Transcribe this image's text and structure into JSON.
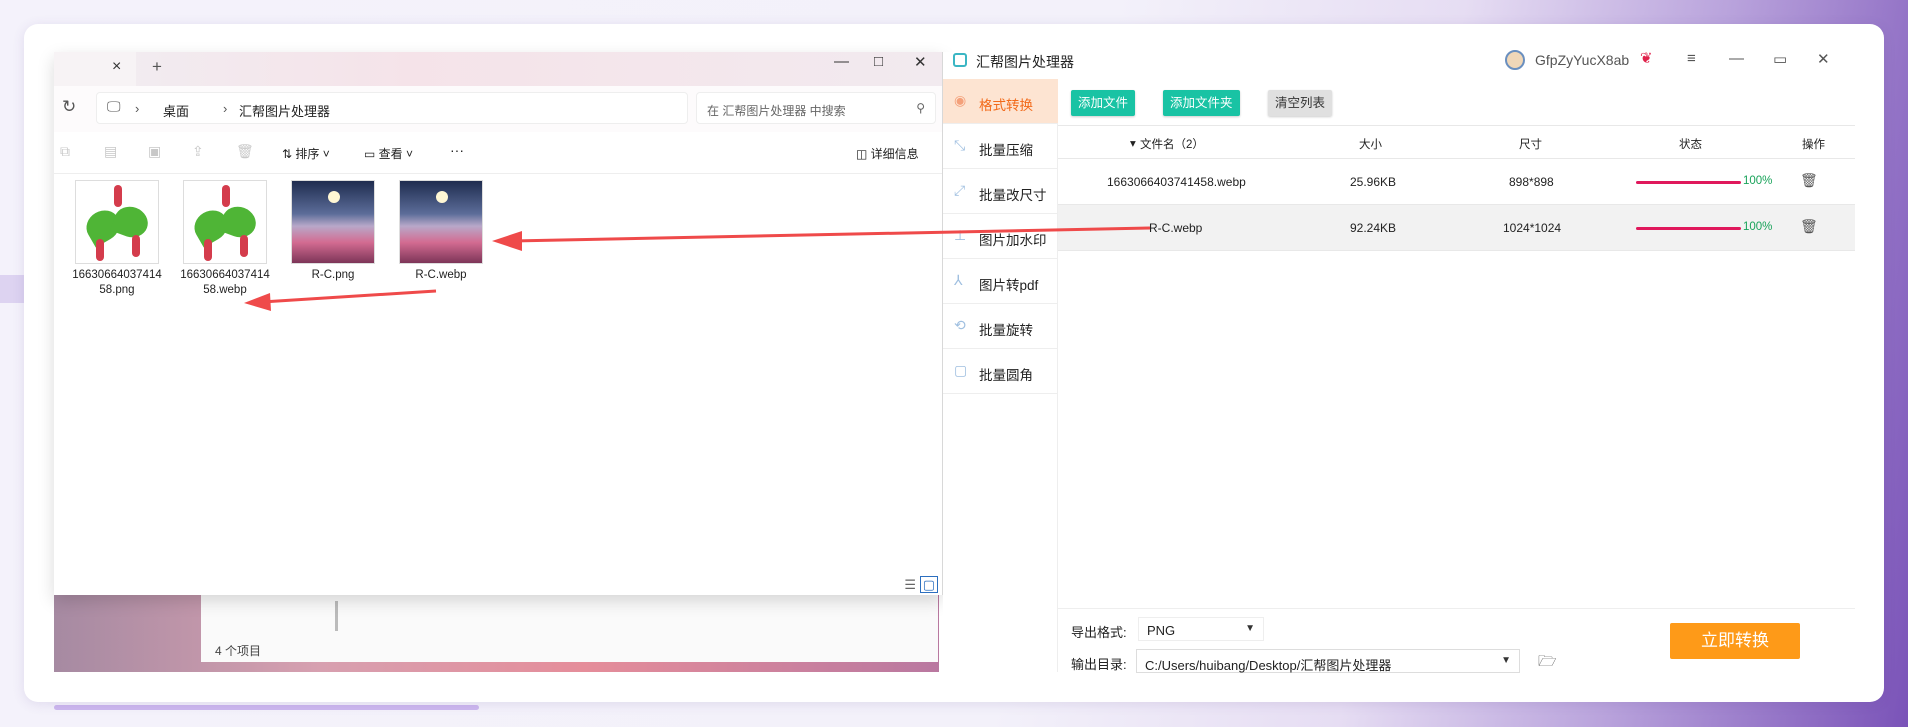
{
  "explorer": {
    "tab_close": "×",
    "new_tab": "+",
    "controls": [
      "—",
      "□",
      "✕"
    ],
    "breadcrumb": [
      "桌面",
      "汇帮图片处理器"
    ],
    "search_placeholder": "在 汇帮图片处理器 中搜索",
    "toolbar": {
      "sort": "排序",
      "view": "查看",
      "more": "···",
      "details": "详细信息"
    },
    "files": [
      {
        "name": "1663066403741458.png",
        "thumb": "dumpling"
      },
      {
        "name": "1663066403741458.webp",
        "thumb": "dumpling"
      },
      {
        "name": "R-C.png",
        "thumb": "moon-lake"
      },
      {
        "name": "R-C.webp",
        "thumb": "moon-lake"
      }
    ],
    "status_count": "4 个项目"
  },
  "app": {
    "title": "汇帮图片处理器",
    "username": "GfpZyYucX8ab",
    "window_controls": [
      "≡",
      "—",
      "▭",
      "✕"
    ],
    "nav": [
      {
        "label": "格式转换",
        "icon": "convert-icon",
        "active": true
      },
      {
        "label": "批量压缩",
        "icon": "compress-icon",
        "active": false
      },
      {
        "label": "批量改尺寸",
        "icon": "resize-icon",
        "active": false
      },
      {
        "label": "图片加水印",
        "icon": "watermark-icon",
        "active": false
      },
      {
        "label": "图片转pdf",
        "icon": "pdf-icon",
        "active": false
      },
      {
        "label": "批量旋转",
        "icon": "rotate-icon",
        "active": false
      },
      {
        "label": "批量圆角",
        "icon": "round-corner-icon",
        "active": false
      }
    ],
    "buttons": {
      "add_file": "添加文件",
      "add_folder": "添加文件夹",
      "clear": "清空列表"
    },
    "columns": {
      "name": "文件名（2）",
      "size": "大小",
      "dims": "尺寸",
      "status": "状态",
      "action": "操作"
    },
    "rows": [
      {
        "name": "1663066403741458.webp",
        "size": "25.96KB",
        "dims": "898*898",
        "progress": 1.0,
        "percent": "100%"
      },
      {
        "name": "R-C.webp",
        "size": "92.24KB",
        "dims": "1024*1024",
        "progress": 1.0,
        "percent": "100%"
      }
    ],
    "export_format_label": "导出格式:",
    "export_format": "PNG",
    "output_dir_label": "输出目录:",
    "output_dir": "C:/Users/huibang/Desktop/汇帮图片处理器",
    "convert_button": "立即转换"
  },
  "colors": {
    "accent_teal": "#19c3a4",
    "accent_orange": "#fe9a18",
    "progress": "#e0185c",
    "annotation_arrow": "#ef4a4a"
  }
}
